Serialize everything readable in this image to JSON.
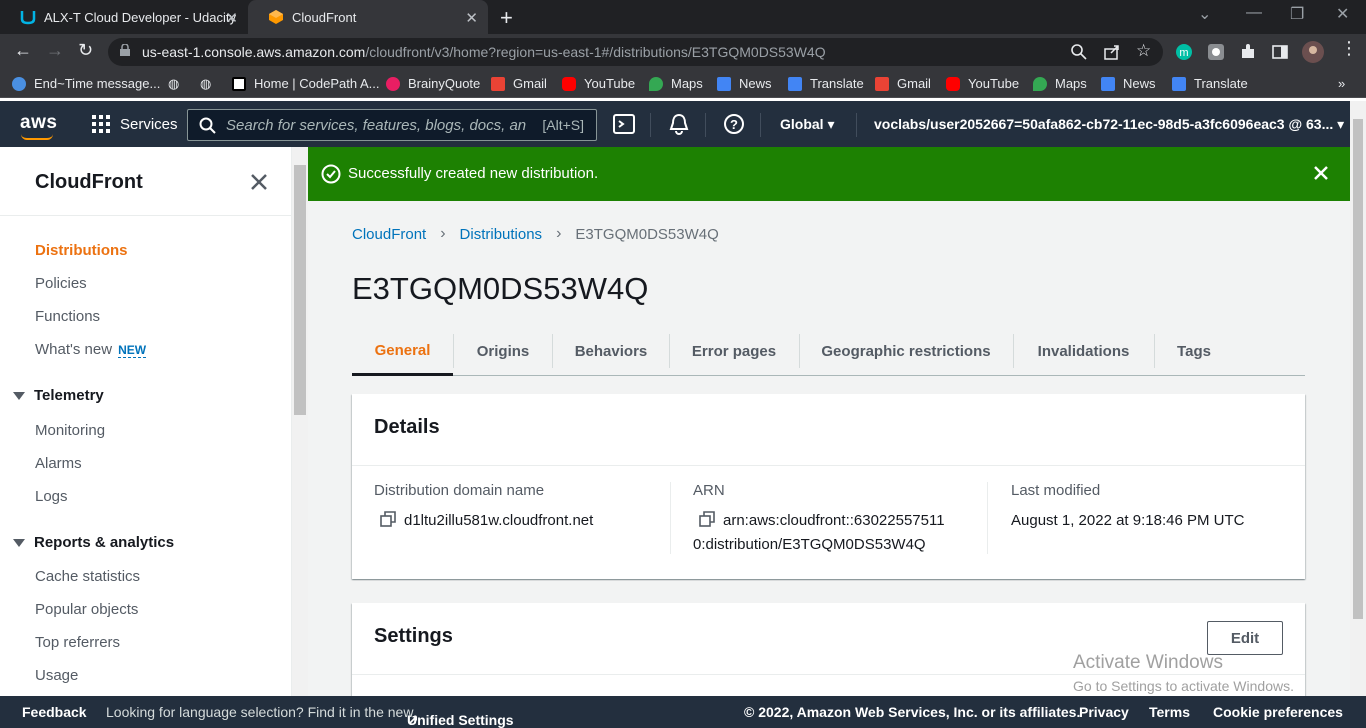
{
  "browser": {
    "tabs": [
      {
        "title": "ALX-T Cloud Developer - Udacity",
        "active": false
      },
      {
        "title": "CloudFront",
        "active": true
      }
    ],
    "url_host": "us-east-1.console.aws.amazon.com",
    "url_path": "/cloudfront/v3/home?region=us-east-1#/distributions/E3TGQM0DS53W4Q",
    "bookmarks": [
      "End~Time message...",
      "Home | CodePath A...",
      "BrainyQuote",
      "Gmail",
      "YouTube",
      "Maps",
      "News",
      "Translate",
      "Gmail",
      "YouTube",
      "Maps",
      "News",
      "Translate"
    ]
  },
  "aws_nav": {
    "logo": "aws",
    "services_label": "Services",
    "search_placeholder": "Search for services, features, blogs, docs, and more",
    "search_shortcut": "[Alt+S]",
    "region": "Global",
    "account": "voclabs/user2052667=50afa862-cb72-11ec-98d5-a3fc6096eac3 @ 63..."
  },
  "sidebar": {
    "title": "CloudFront",
    "items": [
      {
        "label": "Distributions",
        "active": true
      },
      {
        "label": "Policies"
      },
      {
        "label": "Functions"
      },
      {
        "label": "What's new",
        "badge": "NEW"
      }
    ],
    "sections": [
      {
        "title": "Telemetry",
        "items": [
          "Monitoring",
          "Alarms",
          "Logs"
        ]
      },
      {
        "title": "Reports & analytics",
        "items": [
          "Cache statistics",
          "Popular objects",
          "Top referrers",
          "Usage"
        ]
      }
    ]
  },
  "flash": {
    "message": "Successfully created new distribution.",
    "color": "#1d8102"
  },
  "breadcrumbs": [
    "CloudFront",
    "Distributions",
    "E3TGQM0DS53W4Q"
  ],
  "page_title": "E3TGQM0DS53W4Q",
  "tabs": [
    "General",
    "Origins",
    "Behaviors",
    "Error pages",
    "Geographic restrictions",
    "Invalidations",
    "Tags"
  ],
  "details": {
    "title": "Details",
    "domain_label": "Distribution domain name",
    "domain_value": "d1ltu2illu581w.cloudfront.net",
    "arn_label": "ARN",
    "arn_line1": "arn:aws:cloudfront::63022557511",
    "arn_line2": "0:distribution/E3TGQM0DS53W4Q",
    "modified_label": "Last modified",
    "modified_value": "August 1, 2022 at 9:18:46 PM UTC"
  },
  "settings": {
    "title": "Settings",
    "edit_label": "Edit"
  },
  "watermark": {
    "line1": "Activate Windows",
    "line2": "Go to Settings to activate Windows."
  },
  "footer": {
    "feedback": "Feedback",
    "language_text": "Looking for language selection? Find it in the new",
    "unified_settings": "Unified Settings",
    "copyright": "© 2022, Amazon Web Services, Inc. or its affiliates.",
    "privacy": "Privacy",
    "terms": "Terms",
    "cookies": "Cookie preferences"
  },
  "colors": {
    "accent": "#ec7211",
    "link": "#0073bb",
    "aws_nav": "#232f3e",
    "success": "#1d8102"
  }
}
